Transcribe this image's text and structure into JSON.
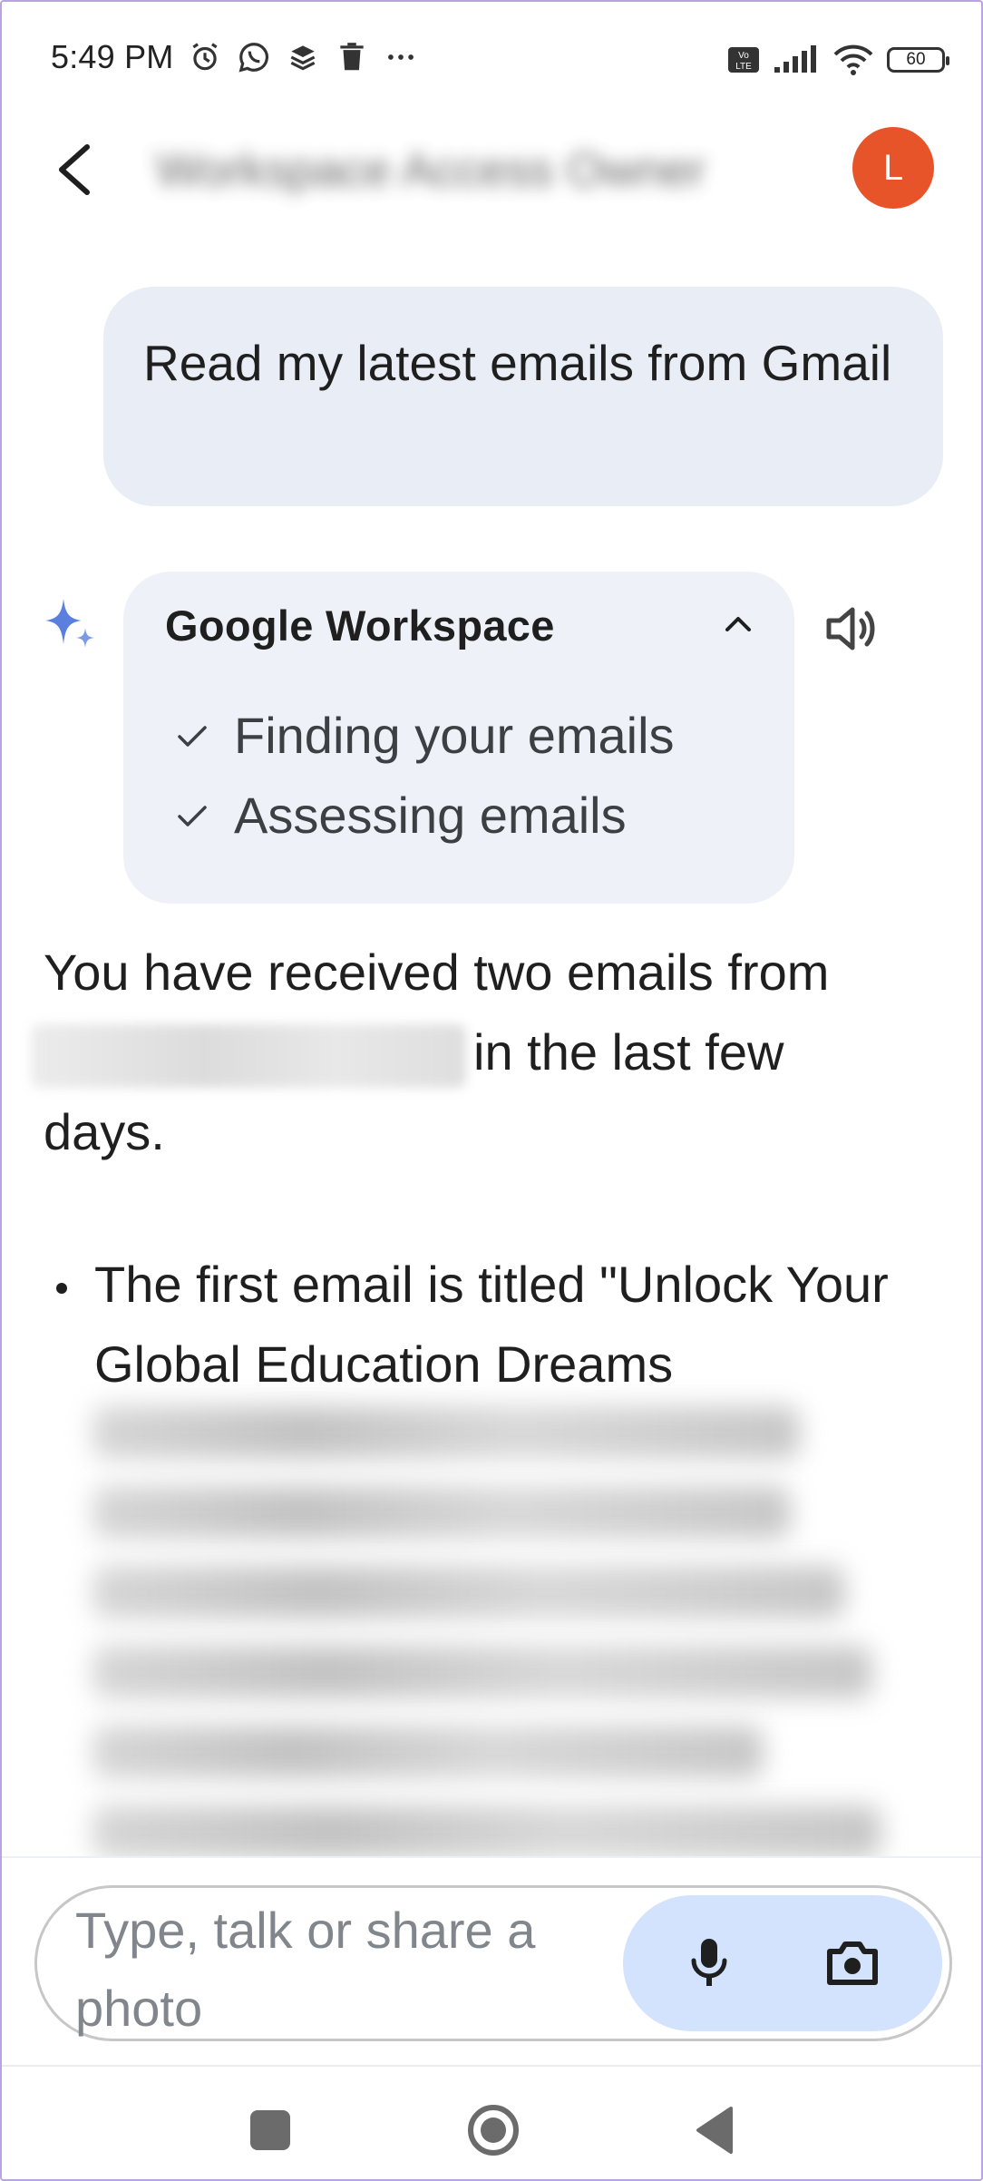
{
  "status_bar": {
    "time": "5:49 PM",
    "left_icons": [
      "alarm-icon",
      "whatsapp-icon",
      "layers-icon",
      "trash-icon",
      "more-icon"
    ],
    "right_icons": [
      "volte-icon",
      "signal-icon",
      "wifi-icon",
      "battery-icon"
    ],
    "battery_level": "60"
  },
  "header": {
    "title": "Workspace Access Owner",
    "avatar_initial": "L",
    "avatar_color": "#e8542a"
  },
  "conversation": {
    "user_message": "Read my latest emails from Gmail",
    "workspace_card": {
      "title": "Google Workspace",
      "steps": [
        "Finding your emails",
        "Assessing emails"
      ]
    },
    "response_intro_before": "You have received two emails from",
    "response_intro_after": "in the last few days.",
    "bullet_visible_text": "The first email is titled \"Unlock Your Global Education Dreams"
  },
  "input": {
    "placeholder": "Type, talk or share a photo",
    "accent_color": "#d3e3fd"
  },
  "colors": {
    "user_bubble": "#e9eef6",
    "card": "#eef2f8",
    "gemini_spark": "#5b7fde"
  }
}
